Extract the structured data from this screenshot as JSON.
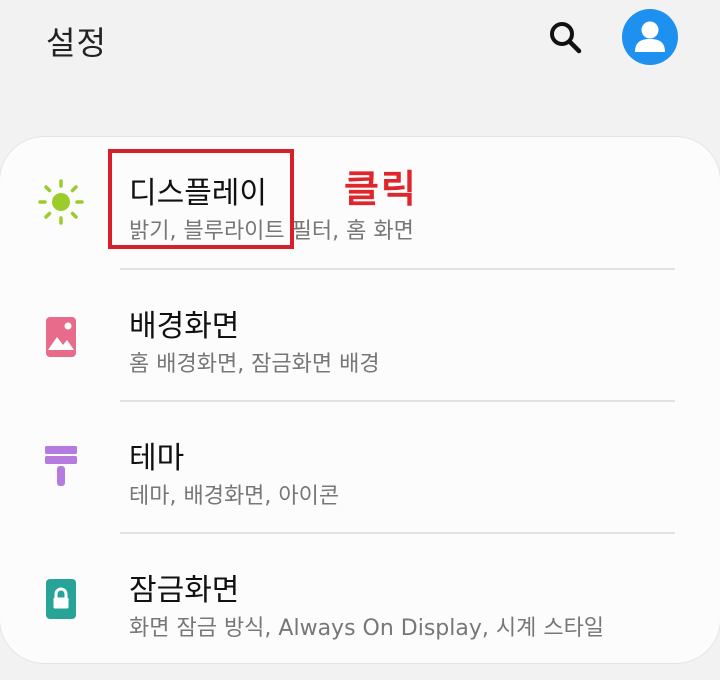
{
  "header": {
    "title": "설정",
    "search_icon": "search-icon",
    "account_icon": "account-icon"
  },
  "items": [
    {
      "label": "디스플레이",
      "subtitle": "밝기, 블루라이트 필터, 홈 화면",
      "icon": "sun-icon",
      "icon_color": "#9ccc2b"
    },
    {
      "label": "배경화면",
      "subtitle": "홈 배경화면, 잠금화면 배경",
      "icon": "wallpaper-icon",
      "icon_color": "#e86b8c"
    },
    {
      "label": "테마",
      "subtitle": "테마, 배경화면, 아이콘",
      "icon": "paintbrush-icon",
      "icon_color": "#b57be0"
    },
    {
      "label": "잠금화면",
      "subtitle": "화면 잠금 방식, Always On Display, 시계 스타일",
      "icon": "lock-icon",
      "icon_color": "#27a497"
    }
  ],
  "annotation": {
    "text": "클릭",
    "color": "#e0262d"
  },
  "colors": {
    "accent": "#1e90f0",
    "background": "#f2f2f2",
    "card": "#fcfcfc"
  }
}
